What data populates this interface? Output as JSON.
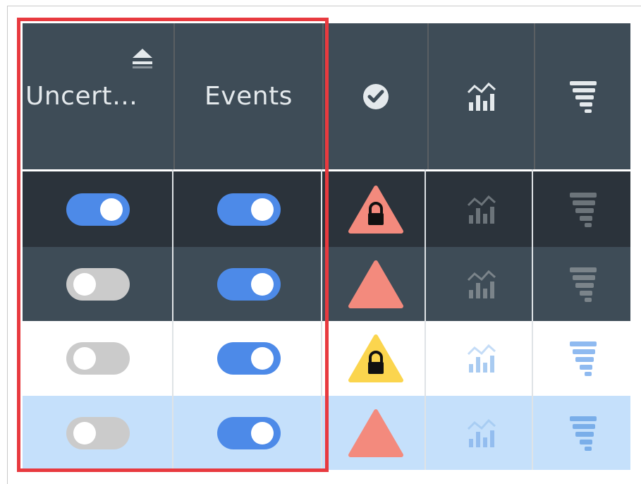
{
  "columns": [
    {
      "label": "Uncert…",
      "sort_icon": "sort-up-icon"
    },
    {
      "label": "Events"
    },
    {
      "icon": "check-circle-icon"
    },
    {
      "icon": "chart-icon"
    },
    {
      "icon": "tornado-icon"
    }
  ],
  "rows": [
    {
      "theme": "dark",
      "uncertainty": "on",
      "events": "on",
      "status": "triangle-lock-red",
      "chart": "dim",
      "tornado": "dim"
    },
    {
      "theme": "slate",
      "uncertainty": "off",
      "events": "on",
      "status": "triangle-red",
      "chart": "dim",
      "tornado": "dim"
    },
    {
      "theme": "white",
      "uncertainty": "off",
      "events": "on",
      "status": "triangle-lock-yellow",
      "chart": "light",
      "tornado": "light"
    },
    {
      "theme": "lightblue",
      "uncertainty": "off",
      "events": "on",
      "status": "triangle-red",
      "chart": "light",
      "tornado": "light"
    }
  ],
  "colors": {
    "header_bg": "#3e4c57",
    "row_dark": "#2b333b",
    "row_slate": "#3e4c57",
    "row_white": "#ffffff",
    "row_lightblue": "#c5e0fb",
    "toggle_on": "#4d8ae8",
    "toggle_off": "#cbcbcb",
    "warning_red": "#f38a7d",
    "warning_yellow": "#fbd54e",
    "highlight_border": "#e83a3f"
  }
}
